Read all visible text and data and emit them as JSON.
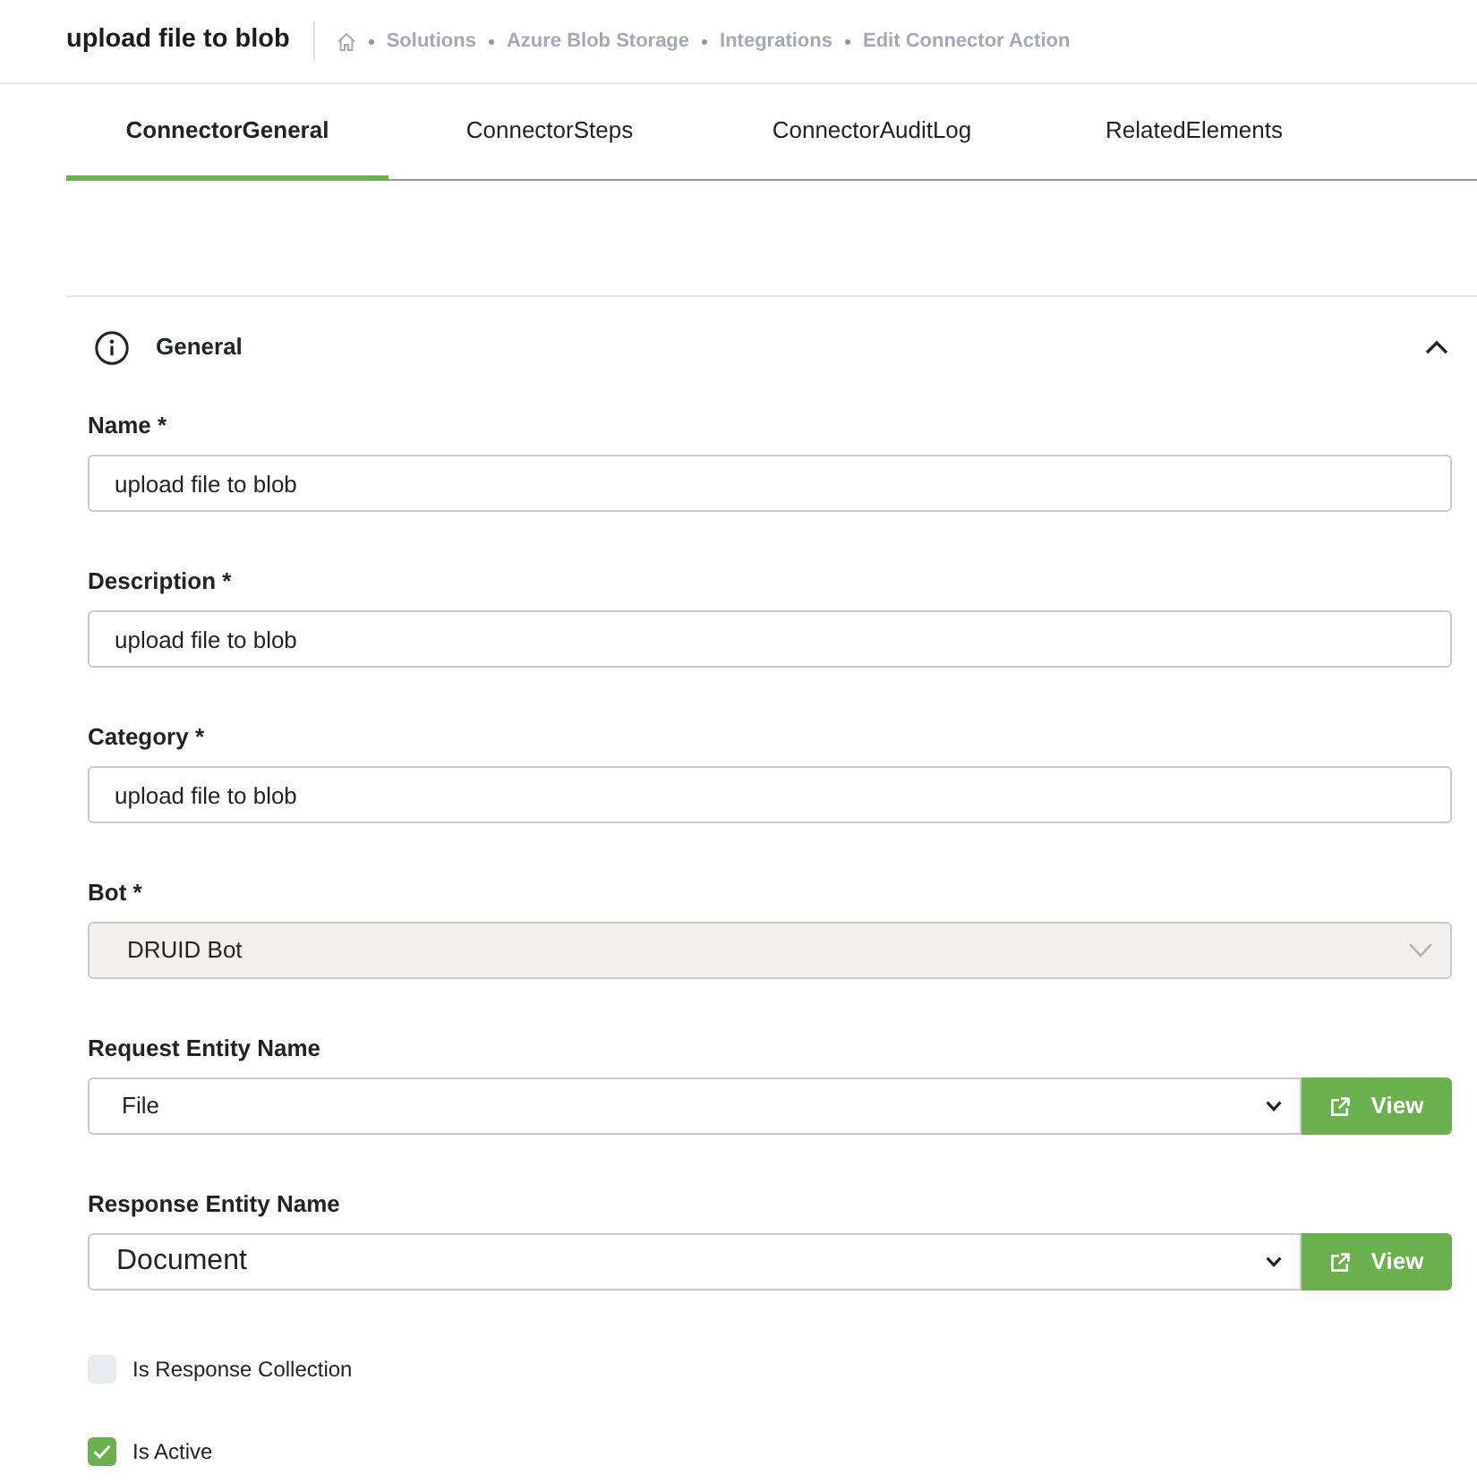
{
  "header": {
    "title": "upload file to blob",
    "breadcrumb": [
      "Solutions",
      "Azure Blob Storage",
      "Integrations",
      "Edit Connector Action"
    ]
  },
  "tabs": [
    {
      "label": "ConnectorGeneral",
      "selected": true
    },
    {
      "label": "ConnectorSteps",
      "selected": false
    },
    {
      "label": "ConnectorAuditLog",
      "selected": false
    },
    {
      "label": "RelatedElements",
      "selected": false
    }
  ],
  "section": {
    "title": "General",
    "expanded": true,
    "fields": [
      {
        "kind": "text",
        "label": "Name *",
        "value": "upload file to blob",
        "disabled": false
      },
      {
        "kind": "text",
        "label": "Description *",
        "value": "upload file to blob",
        "disabled": false
      },
      {
        "kind": "text",
        "label": "Category *",
        "value": "upload file to blob",
        "disabled": false
      },
      {
        "kind": "select",
        "label": "Bot *",
        "value": "DRUID Bot",
        "disabled": true
      },
      {
        "kind": "select_view",
        "label": "Request Entity Name",
        "value": "File",
        "button": "View",
        "disabled": false
      },
      {
        "kind": "select_view",
        "label": "Response Entity Name",
        "value": "Document",
        "button": "View",
        "disabled": false
      }
    ],
    "checkboxes": [
      {
        "label": "Is Response Collection",
        "checked": false
      },
      {
        "label": "Is Active",
        "checked": true
      }
    ]
  }
}
